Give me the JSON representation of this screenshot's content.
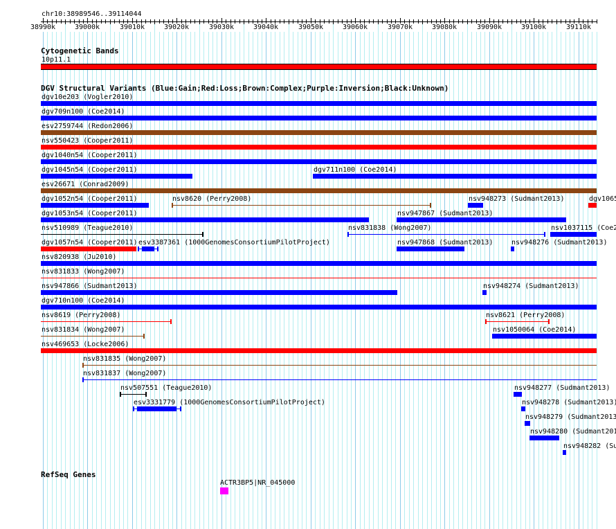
{
  "view": {
    "chrom": "chr10",
    "start": 38989546,
    "end": 39114044,
    "location_label": "chr10:38989546..39114044"
  },
  "ruler": {
    "tick_labels": [
      "38990k",
      "39000k",
      "39010k",
      "39020k",
      "39030k",
      "39040k",
      "39050k",
      "39060k",
      "39070k",
      "39080k",
      "39090k",
      "39100k",
      "39110k"
    ],
    "first_major": 38990000,
    "major_step": 10000,
    "minor_step": 1000
  },
  "colors": {
    "gain": "#0000ff",
    "loss": "#ff0000",
    "complex": "#8b4513",
    "inversion": "#800080",
    "unknown": "#000000",
    "gene": "#ff00ff",
    "minor_grid": "#b4eef0",
    "major_grid": "#8ccbe8"
  },
  "tracks": {
    "cyto": {
      "title": "Cytogenetic Bands",
      "band": {
        "label": "10p11.1",
        "start": 38989546,
        "end": 39114044
      }
    },
    "dgv": {
      "title": "DGV Structural Variants (Blue:Gain;Red:Loss;Brown:Complex;Purple:Inversion;Black:Unknown)",
      "rows": [
        [
          {
            "label": "dgv10e203 (Vogler2010)",
            "start": 38989546,
            "end": 39114044,
            "type": "gain",
            "style": "bar"
          }
        ],
        [
          {
            "label": "dgv709n100 (Coe2014)",
            "start": 38989546,
            "end": 39114044,
            "type": "gain",
            "style": "bar"
          }
        ],
        [
          {
            "label": "esv2759744 (Redon2006)",
            "start": 38989546,
            "end": 39114044,
            "type": "complex",
            "style": "bar"
          }
        ],
        [
          {
            "label": "nsv550423 (Cooper2011)",
            "start": 38989546,
            "end": 39114044,
            "type": "loss",
            "style": "bar"
          }
        ],
        [
          {
            "label": "dgv1040n54 (Cooper2011)",
            "start": 38989546,
            "end": 39114044,
            "type": "gain",
            "style": "bar"
          }
        ],
        [
          {
            "label": "dgv1045n54 (Cooper2011)",
            "start": 38989546,
            "end": 39023500,
            "type": "gain",
            "style": "bar"
          },
          {
            "label": "dgv711n100 (Coe2014)",
            "start": 39050477,
            "end": 39114044,
            "type": "gain",
            "style": "bar"
          }
        ],
        [
          {
            "label": "esv26671 (Conrad2009)",
            "start": 38989546,
            "end": 39114044,
            "type": "complex",
            "style": "bar"
          }
        ],
        [
          {
            "label": "dgv1052n54 (Cooper2011)",
            "start": 38989546,
            "end": 39013732,
            "type": "gain",
            "style": "bar"
          },
          {
            "label": "nsv8620 (Perry2008)",
            "start": 39018849,
            "end": 39076989,
            "type": "complex",
            "style": "line"
          },
          {
            "label": "nsv948273 (Sudmant2013)",
            "start": 39085206,
            "end": 39088617,
            "type": "gain",
            "style": "bar"
          },
          {
            "label": "dgv1065",
            "start": 39112183,
            "end": 39114044,
            "type": "loss",
            "style": "bar"
          }
        ],
        [
          {
            "label": "dgv1053n54 (Cooper2011)",
            "start": 38989546,
            "end": 39063035,
            "type": "gain",
            "style": "bar"
          },
          {
            "label": "nsv947867 (Sudmant2013)",
            "start": 39069237,
            "end": 39107221,
            "type": "gain",
            "style": "bar"
          }
        ],
        [
          {
            "label": "nsv510989 (Teague2010)",
            "start": 38989546,
            "end": 39025980,
            "type": "unknown",
            "style": "line"
          },
          {
            "label": "nsv831838 (Wong2007)",
            "start": 39058229,
            "end": 39102570,
            "type": "gain",
            "style": "line"
          },
          {
            "label": "nsv1037115 (Coe2",
            "start": 39103655,
            "end": 39114044,
            "type": "gain",
            "style": "bar"
          }
        ],
        [
          {
            "label": "dgv1057n54 (Cooper2011)",
            "start": 38989546,
            "end": 39010942,
            "type": "loss",
            "style": "bar"
          },
          {
            "label": "esv3387361 (1000GenomesConsortiumPilotProject)",
            "start": 39011252,
            "end": 39015903,
            "thick_start": 39012182,
            "thick_end": 39014973,
            "type": "gain",
            "style": "thick"
          },
          {
            "label": "nsv947868 (Sudmant2013)",
            "start": 39069237,
            "end": 39084430,
            "type": "gain",
            "style": "bar"
          },
          {
            "label": "nsv948276 (Sudmant2013)",
            "start": 39094818,
            "end": 39095593,
            "type": "gain",
            "style": "bar"
          }
        ],
        [
          {
            "label": "nsv820938 (Ju2010)",
            "start": 38989546,
            "end": 39114044,
            "type": "gain",
            "style": "bar"
          }
        ],
        [
          {
            "label": "nsv831833 (Wong2007)",
            "start": 38989546,
            "end": 39114044,
            "type": "loss",
            "style": "line"
          }
        ],
        [
          {
            "label": "nsv947866 (Sudmant2013)",
            "start": 38989546,
            "end": 39069392,
            "type": "gain",
            "style": "bar"
          },
          {
            "label": "nsv948274 (Sudmant2013)",
            "start": 39088462,
            "end": 39089392,
            "type": "gain",
            "style": "bar"
          }
        ],
        [
          {
            "label": "dgv710n100 (Coe2014)",
            "start": 38989546,
            "end": 39114044,
            "type": "gain",
            "style": "bar"
          }
        ],
        [
          {
            "label": "nsv8619 (Perry2008)",
            "start": 38989546,
            "end": 39018849,
            "type": "loss",
            "style": "line"
          },
          {
            "label": "nsv8621 (Perry2008)",
            "start": 39089082,
            "end": 39103500,
            "type": "loss",
            "style": "line"
          }
        ],
        [
          {
            "label": "nsv831834 (Wong2007)",
            "start": 38989546,
            "end": 39012802,
            "type": "complex",
            "style": "line"
          },
          {
            "label": "nsv1050064 (Coe2014)",
            "start": 39090632,
            "end": 39114044,
            "type": "gain",
            "style": "bar"
          }
        ],
        [
          {
            "label": "nsv469653 (Locke2006)",
            "start": 38989546,
            "end": 39114044,
            "type": "loss",
            "style": "bar"
          }
        ],
        [
          {
            "label": "nsv831835 (Wong2007)",
            "start": 38998848,
            "end": 39114044,
            "type": "complex",
            "style": "line"
          }
        ],
        [
          {
            "label": "nsv831837 (Wong2007)",
            "start": 38998848,
            "end": 39114044,
            "type": "gain",
            "style": "line"
          }
        ],
        [
          {
            "label": "nsv507551 (Teague2010)",
            "start": 39007221,
            "end": 39013267,
            "type": "unknown",
            "style": "line"
          },
          {
            "label": "nsv948277 (Sudmant2013)",
            "start": 39095438,
            "end": 39097299,
            "type": "gain",
            "style": "bar"
          }
        ],
        [
          {
            "label": "esv3331779 (1000GenomesConsortiumPilotProject)",
            "start": 39010166,
            "end": 39021019,
            "thick_start": 39011097,
            "thick_end": 39019934,
            "type": "gain",
            "style": "thick"
          },
          {
            "label": "nsv948278 (Sudmant2013)",
            "start": 39097144,
            "end": 39098074,
            "type": "gain",
            "style": "bar"
          }
        ],
        [
          {
            "label": "nsv948279 (Sudmant2013",
            "start": 39097919,
            "end": 39099159,
            "type": "gain",
            "style": "bar"
          }
        ],
        [
          {
            "label": "nsv948280 (Sudmant201",
            "start": 39099004,
            "end": 39105671,
            "type": "gain",
            "style": "bar"
          }
        ],
        [
          {
            "label": "nsv948282 (Su",
            "start": 39106446,
            "end": 39107221,
            "type": "gain",
            "style": "bar"
          }
        ]
      ]
    },
    "refseq": {
      "title": "RefSeq Genes",
      "genes": [
        {
          "label": "ACTR3BP5|NR_045000",
          "start": 39029701,
          "end": 39031562
        }
      ]
    }
  }
}
